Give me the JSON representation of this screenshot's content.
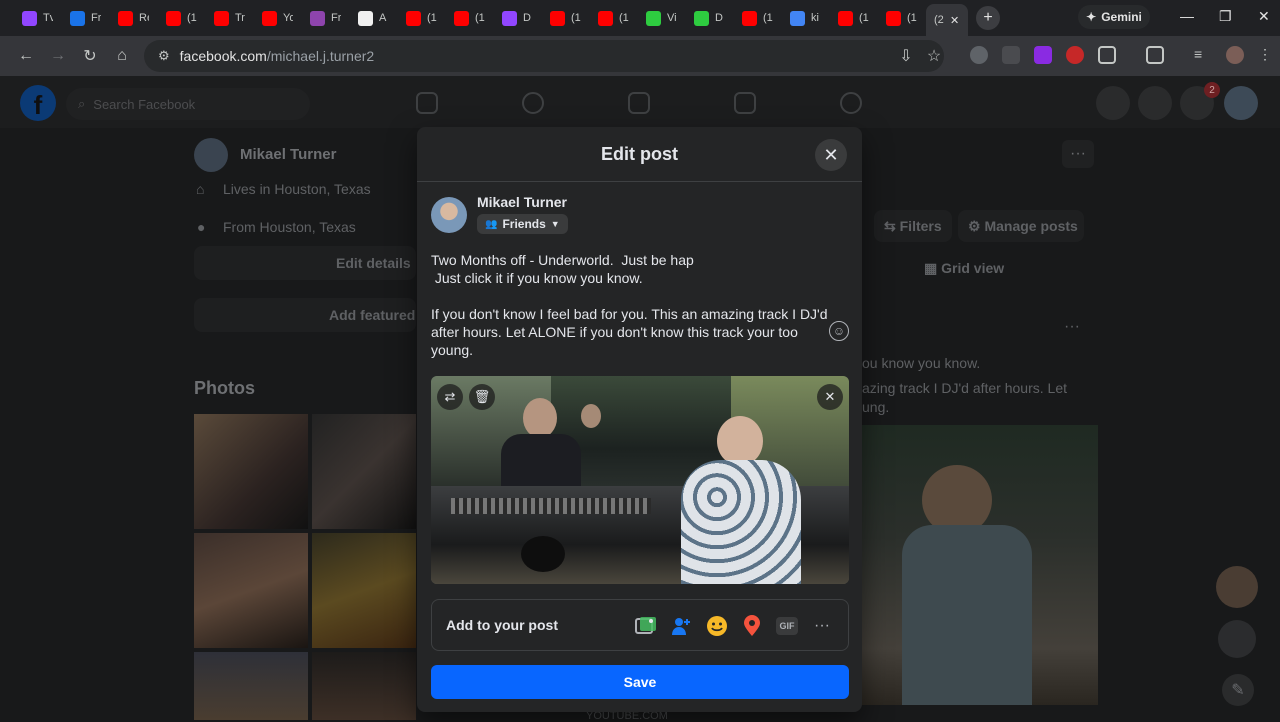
{
  "browser": {
    "tabs": [
      {
        "title": "Tv",
        "color": "#9146ff"
      },
      {
        "title": "Fr",
        "color": "#1a73e8"
      },
      {
        "title": "Re",
        "color": "#ff0000"
      },
      {
        "title": "(1",
        "color": "#ff0000"
      },
      {
        "title": "Tr",
        "color": "#ff0000"
      },
      {
        "title": "Yo",
        "color": "#ff0000"
      },
      {
        "title": "Fr",
        "color": "#8e44ad"
      },
      {
        "title": "A",
        "color": "#f0f0f0"
      },
      {
        "title": "(1",
        "color": "#ff0000"
      },
      {
        "title": "(1",
        "color": "#ff0000"
      },
      {
        "title": "D",
        "color": "#9146ff"
      },
      {
        "title": "(1",
        "color": "#ff0000"
      },
      {
        "title": "(1",
        "color": "#ff0000"
      },
      {
        "title": "Vi",
        "color": "#2ecc40"
      },
      {
        "title": "D",
        "color": "#2ecc40"
      },
      {
        "title": "(1",
        "color": "#ff0000"
      },
      {
        "title": "ki",
        "color": "#4285f4"
      },
      {
        "title": "(1",
        "color": "#ff0000"
      },
      {
        "title": "(1",
        "color": "#ff0000"
      }
    ],
    "active_tab": {
      "title": "(2",
      "close": "✕"
    },
    "new_tab": "+",
    "gemini_label": "Gemini",
    "url_host": "facebook.com",
    "url_path": "/michael.j.turner2"
  },
  "background": {
    "search_placeholder": "Search Facebook",
    "profile_name": "Mikael Turner",
    "lives_in": "Lives in Houston, Texas",
    "from": "From Houston, Texas",
    "edit_details": "Edit details",
    "add_featured": "Add featured",
    "photos_heading": "Photos",
    "filters": "Filters",
    "manage_posts": "Manage posts",
    "grid_view": "Grid view",
    "post_snippet_1": "ou know you know.",
    "post_snippet_2": "azing track I DJ'd after hours. Let",
    "post_snippet_3": "ung.",
    "notif_count": "2",
    "bottom_text": "YOUTUBE.COM"
  },
  "modal": {
    "title": "Edit post",
    "close_icon": "✕",
    "author_name": "Mikael Turner",
    "audience": "Friends",
    "post_line_1": "Two Months off - Underworld.  Just be hap",
    "post_line_2": " Just click it if you know you know.",
    "post_line_3": "If you don't know I feel bad for you. This an amazing track I DJ'd after hours. Let ALONE if you don't know this track your too young.",
    "add_to_post": "Add to your post",
    "save_label": "Save",
    "icons": {
      "photo": "photo-icon",
      "tag": "tag-people-icon",
      "feeling": "feeling-icon",
      "location": "location-icon",
      "gif": "GIF",
      "more": "···"
    },
    "colors": {
      "photo": "#45bd62",
      "tag": "#1877f2",
      "feeling": "#f7b928",
      "location": "#f5533d",
      "save": "#0866ff"
    }
  }
}
